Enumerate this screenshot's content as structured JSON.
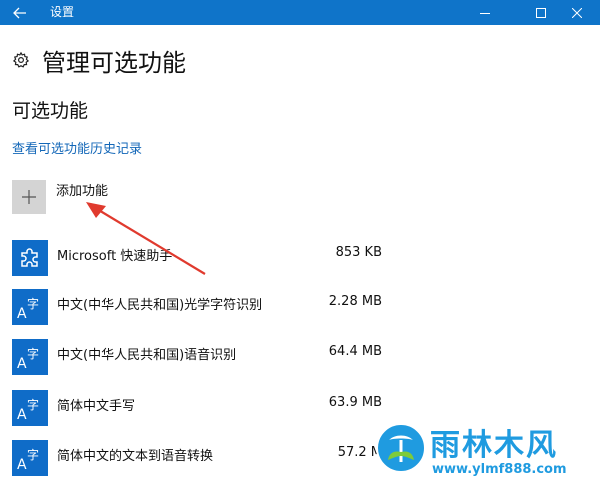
{
  "window": {
    "title": "设置"
  },
  "page": {
    "title": "管理可选功能",
    "section_title": "可选功能",
    "history_link": "查看可选功能历史记录",
    "add_label": "添加功能"
  },
  "features": [
    {
      "name": "Microsoft 快速助手",
      "size": "853 KB",
      "icon": "puzzle-icon"
    },
    {
      "name": "中文(中华人民共和国)光学字符识别",
      "size": "2.28 MB",
      "icon": "language-icon"
    },
    {
      "name": "中文(中华人民共和国)语音识别",
      "size": "64.4 MB",
      "icon": "language-icon"
    },
    {
      "name": "简体中文手写",
      "size": "63.9 MB",
      "icon": "language-icon"
    },
    {
      "name": "简体中文的文本到语音转换",
      "size": "57.2 M",
      "icon": "language-icon"
    }
  ],
  "watermark": {
    "name": "雨林木风",
    "url": "www.ylmf888.com"
  },
  "colors": {
    "titlebar": "#0f74c9",
    "accent": "#0f6cc8",
    "link": "#1367b8",
    "add_tile": "#d4d4d4",
    "arrow": "#e03a2e",
    "watermark": "#1f9be0"
  }
}
